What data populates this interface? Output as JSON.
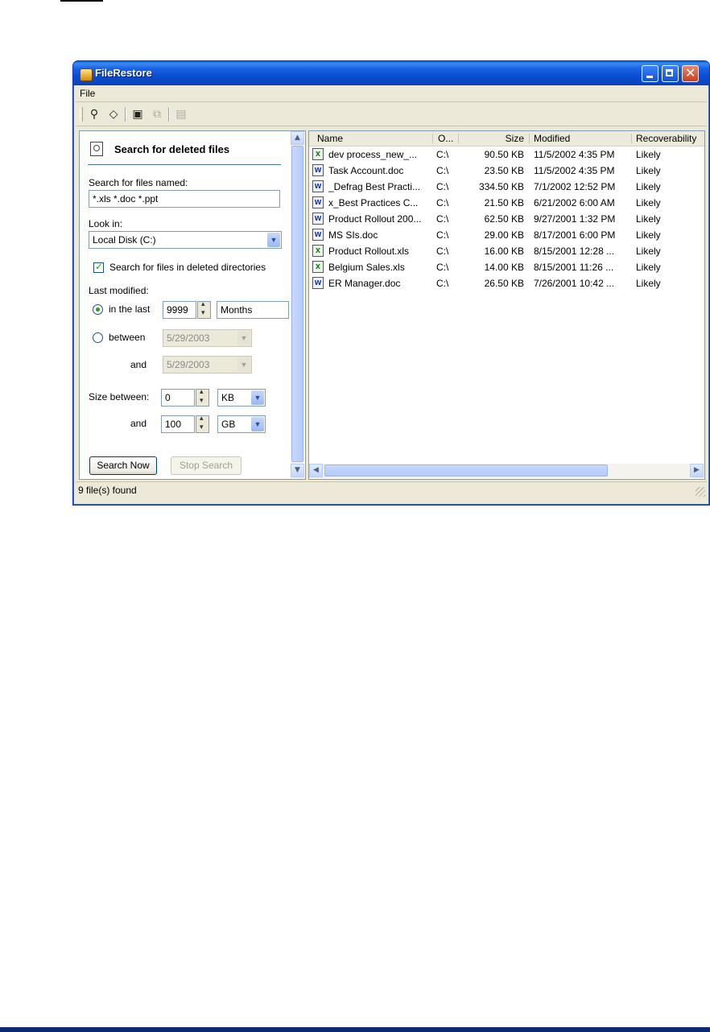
{
  "window": {
    "title": "FileRestore",
    "status_text": "9 file(s) found"
  },
  "menubar": {
    "file": "File"
  },
  "toolbar": {
    "buttons": [
      "search-icon",
      "erase-icon",
      "save-icon",
      "copy-icon",
      "properties-icon"
    ]
  },
  "search_panel": {
    "title": "Search for deleted files",
    "name_label": "Search for files named:",
    "name_value": "*.xls *.doc *.ppt",
    "look_in_label": "Look in:",
    "look_in_value": "Local Disk (C:)",
    "deleted_dirs_label": "Search for files in deleted directories",
    "deleted_dirs_checked": true,
    "last_modified_label": "Last modified:",
    "in_the_last_label": "in the last",
    "in_the_last_value": "9999",
    "period_unit": "Months",
    "between_label": "between",
    "between_from": "5/29/2003",
    "and_label": "and",
    "between_to": "5/29/2003",
    "size_between_label": "Size between:",
    "size_min": "0",
    "size_min_unit": "KB",
    "size_and_label": "and",
    "size_max": "100",
    "size_max_unit": "GB",
    "search_now": "Search Now",
    "stop_search": "Stop Search"
  },
  "results": {
    "columns": [
      "Name",
      "O...",
      "Size",
      "Modified",
      "Recoverability"
    ],
    "rows": [
      {
        "type": "xls",
        "name": "dev process_new_...",
        "origin": "C:\\",
        "size": "90.50 KB",
        "modified": "11/5/2002 4:35 PM",
        "recoverability": "Likely"
      },
      {
        "type": "doc",
        "name": "Task Account.doc",
        "origin": "C:\\",
        "size": "23.50 KB",
        "modified": "11/5/2002 4:35 PM",
        "recoverability": "Likely"
      },
      {
        "type": "doc",
        "name": "_Defrag Best Practi...",
        "origin": "C:\\",
        "size": "334.50 KB",
        "modified": "7/1/2002 12:52 PM",
        "recoverability": "Likely"
      },
      {
        "type": "doc",
        "name": "x_Best Practices C...",
        "origin": "C:\\",
        "size": "21.50 KB",
        "modified": "6/21/2002 6:00 AM",
        "recoverability": "Likely"
      },
      {
        "type": "doc",
        "name": "Product Rollout 200...",
        "origin": "C:\\",
        "size": "62.50 KB",
        "modified": "9/27/2001 1:32 PM",
        "recoverability": "Likely"
      },
      {
        "type": "doc",
        "name": "MS SIs.doc",
        "origin": "C:\\",
        "size": "29.00 KB",
        "modified": "8/17/2001 6:00 PM",
        "recoverability": "Likely"
      },
      {
        "type": "xls",
        "name": "Product Rollout.xls",
        "origin": "C:\\",
        "size": "16.00 KB",
        "modified": "8/15/2001 12:28 ...",
        "recoverability": "Likely"
      },
      {
        "type": "xls",
        "name": "Belgium Sales.xls",
        "origin": "C:\\",
        "size": "14.00 KB",
        "modified": "8/15/2001 11:26 ...",
        "recoverability": "Likely"
      },
      {
        "type": "doc",
        "name": "ER Manager.doc",
        "origin": "C:\\",
        "size": "26.50 KB",
        "modified": "7/26/2001 10:42 ...",
        "recoverability": "Likely"
      }
    ]
  },
  "colors": {
    "titlebar": "#0a5fd8",
    "window_face": "#ece9d8",
    "field_border": "#7f9db9",
    "bottom_bar": "#0b2a6f"
  }
}
